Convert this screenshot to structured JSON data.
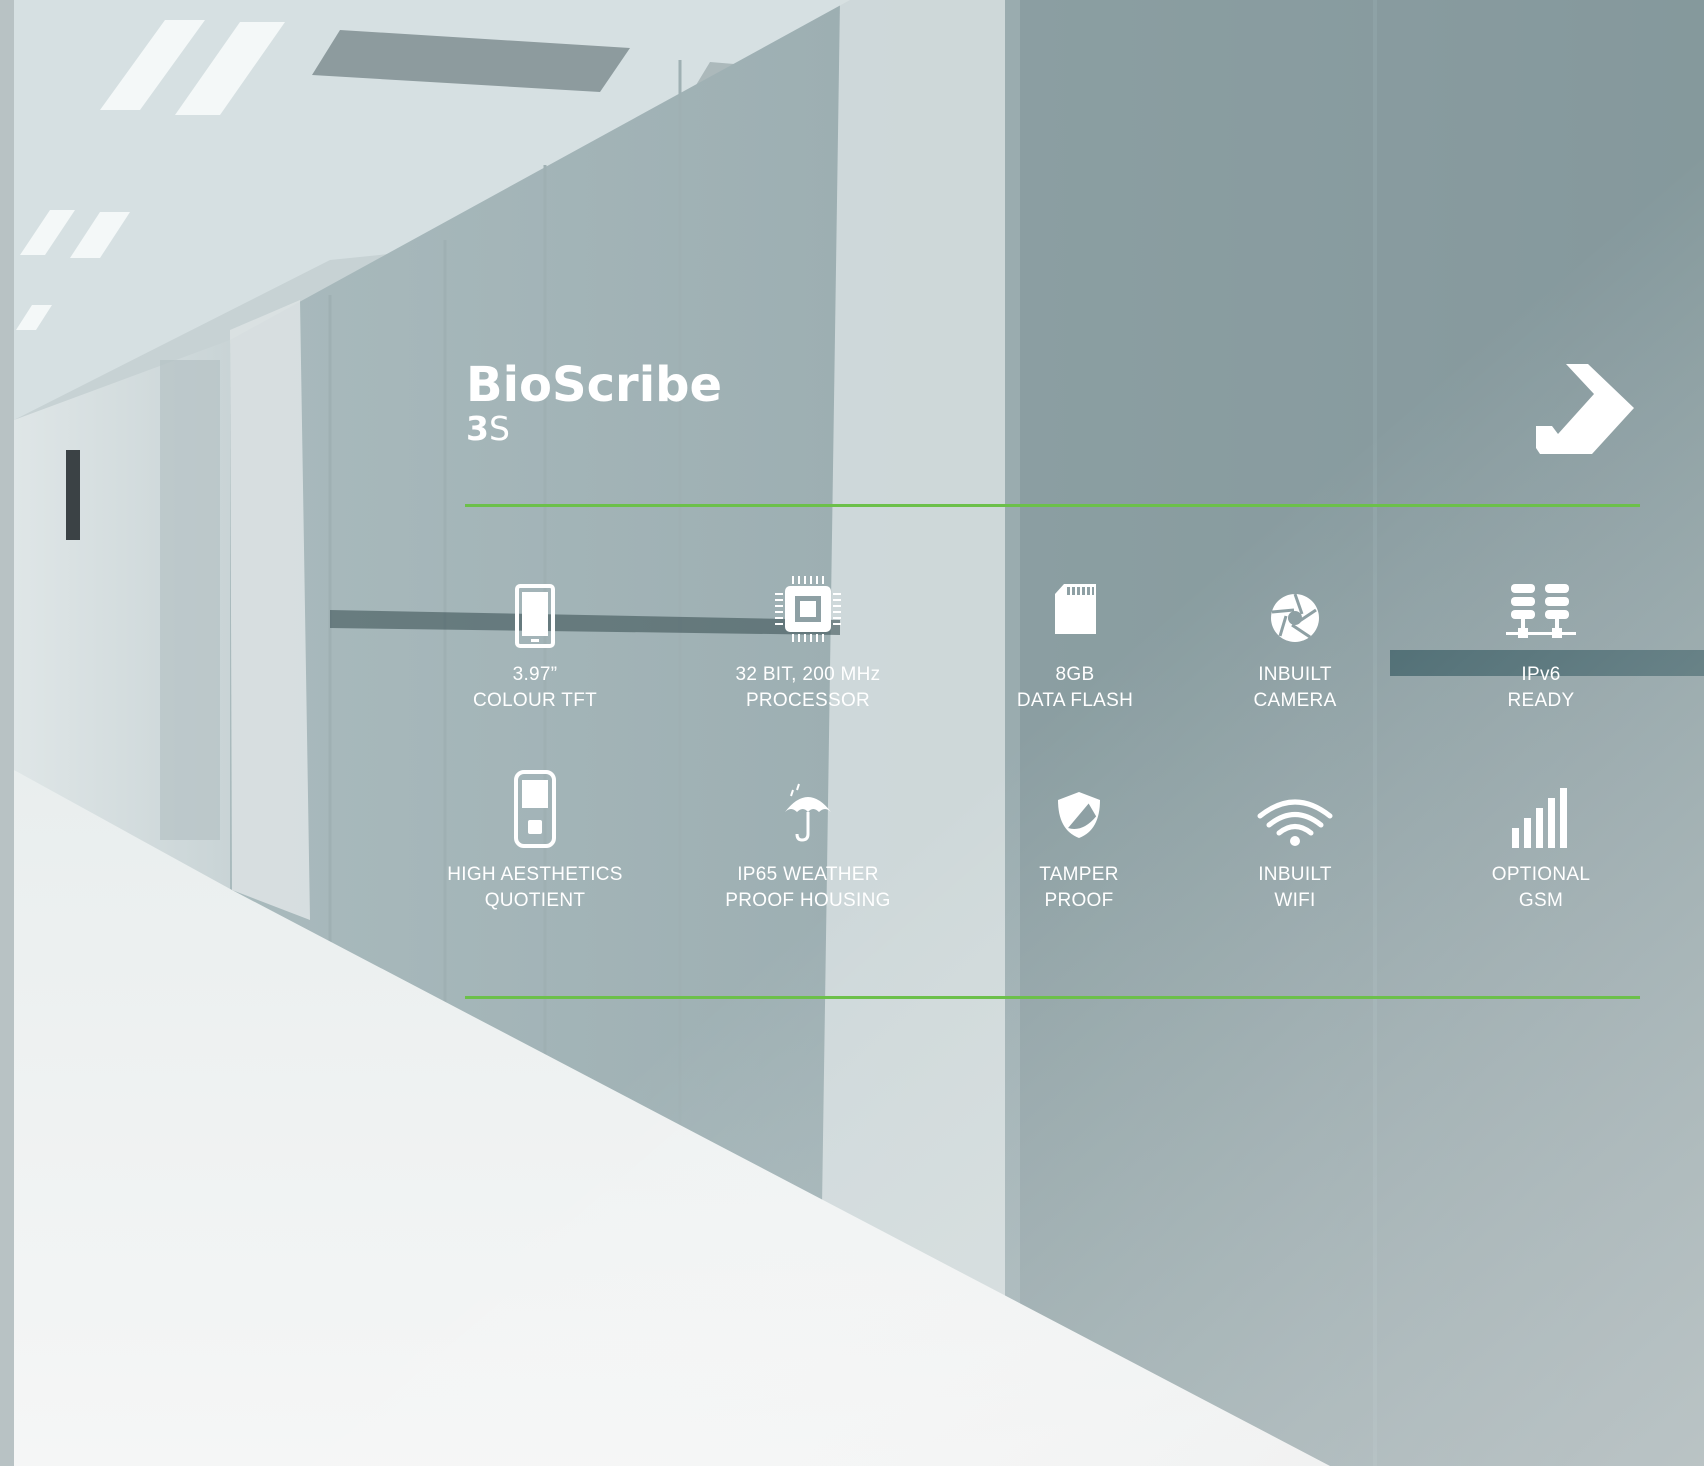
{
  "product": {
    "name": "BioScribe",
    "model_number": "3",
    "model_suffix": "S"
  },
  "accent_color": "#6cc04a",
  "features": [
    {
      "icon": "tablet-screen-icon",
      "line1": "3.97”",
      "line2": "COLOUR TFT"
    },
    {
      "icon": "processor-chip-icon",
      "line1": "32 BIT, 200 MHz",
      "line2": "PROCESSOR"
    },
    {
      "icon": "sd-card-icon",
      "line1": "8GB",
      "line2": "DATA FLASH"
    },
    {
      "icon": "camera-aperture-icon",
      "line1": "INBUILT",
      "line2": "CAMERA"
    },
    {
      "icon": "network-server-icon",
      "line1": "IPv6",
      "line2": "READY"
    },
    {
      "icon": "device-icon",
      "line1": "HIGH AESTHETICS",
      "line2": "QUOTIENT"
    },
    {
      "icon": "umbrella-rain-icon",
      "line1": "IP65 WEATHER",
      "line2": "PROOF HOUSING"
    },
    {
      "icon": "shield-icon",
      "line1": "TAMPER",
      "line2": "PROOF"
    },
    {
      "icon": "wifi-icon",
      "line1": "INBUILT",
      "line2": "WIFI"
    },
    {
      "icon": "signal-bars-icon",
      "line1": "OPTIONAL",
      "line2": "GSM"
    }
  ]
}
